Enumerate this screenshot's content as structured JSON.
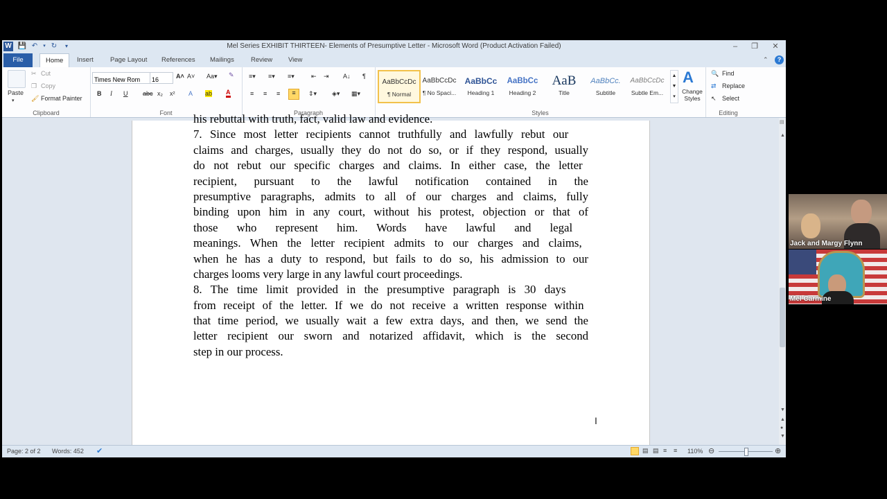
{
  "window": {
    "title": "Mel Series EXHIBIT THIRTEEN- Elements of Presumptive Letter  -  Microsoft Word (Product Activation Failed)"
  },
  "tabs": [
    "File",
    "Home",
    "Insert",
    "Page Layout",
    "References",
    "Mailings",
    "Review",
    "View"
  ],
  "clipboard": {
    "paste": "Paste",
    "cut": "Cut",
    "copy": "Copy",
    "format_painter": "Format Painter",
    "label": "Clipboard"
  },
  "font": {
    "name": "Times New Rom",
    "size": "16",
    "label": "Font"
  },
  "paragraph": {
    "label": "Paragraph"
  },
  "styles": {
    "label": "Styles",
    "items": [
      {
        "preview": "AaBbCcDc",
        "name": "¶ Normal"
      },
      {
        "preview": "AaBbCcDc",
        "name": "¶ No Spaci..."
      },
      {
        "preview": "AaBbCc",
        "name": "Heading 1"
      },
      {
        "preview": "AaBbCc",
        "name": "Heading 2"
      },
      {
        "preview": "AaB",
        "name": "Title"
      },
      {
        "preview": "AaBbCc.",
        "name": "Subtitle"
      },
      {
        "preview": "AaBbCcDc",
        "name": "Subtle Em..."
      }
    ],
    "change_styles": "Change Styles"
  },
  "editing": {
    "find": "Find",
    "replace": "Replace",
    "select": "Select",
    "label": "Editing"
  },
  "document": {
    "lines": [
      "his rebuttal with truth, fact, valid law and evidence.",
      "7.     Since most letter recipients cannot truthfully and lawfully rebut our",
      "claims and charges, usually they do not do so, or if they respond, usually",
      "do not rebut our specific charges and claims.  In either case, the letter",
      "recipient, pursuant to the lawful notification contained in the",
      "presumptive paragraphs, admits to all of our charges and claims, fully",
      "binding upon him in any court, without his protest, objection or that of",
      "those who represent him.  Words have lawful and legal",
      "meanings.  When the letter recipient admits to our charges and claims,",
      "when he has a duty to respond, but fails to do so, his admission to our",
      "charges looms very large in any lawful court proceedings.",
      "8.     The time limit provided in the presumptive paragraph is 30 days",
      "from receipt of the letter.  If we do not receive a written response within",
      "that time period, we usually wait a few extra days, and then, we send the",
      "letter recipient our sworn and notarized affidavit, which is the second",
      "step in our process."
    ]
  },
  "status": {
    "page": "Page: 2 of 2",
    "words": "Words: 452",
    "zoom": "110%"
  },
  "participants": [
    {
      "name": "Jack and Margy Flynn"
    },
    {
      "name": "Mel Carmine"
    }
  ],
  "colors": {
    "file_tab": "#2a5ea8",
    "style_selected": "#f2c14a",
    "heading_blue": "#2f5496"
  }
}
